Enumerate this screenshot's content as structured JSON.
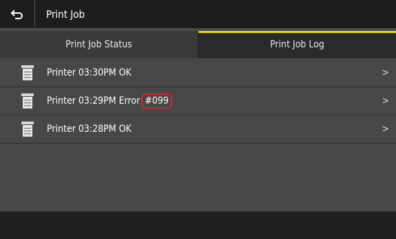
{
  "header": {
    "back_icon": "back-arrow-icon",
    "title": "Print Job"
  },
  "tabs": [
    {
      "label": "Print Job Status",
      "active": false
    },
    {
      "label": "Print Job Log",
      "active": true
    }
  ],
  "log": [
    {
      "icon": "printer-icon",
      "label": "Printer 03:30PM OK"
    },
    {
      "icon": "printer-icon",
      "label_prefix": "Printer 03:29PM Error",
      "error_code": "#099"
    },
    {
      "icon": "printer-icon",
      "label": "Printer 03:28PM OK"
    }
  ],
  "chevron": ">",
  "colors": {
    "accent": "#f5d800",
    "highlight": "#e0232a",
    "background": "#474747",
    "titlebar": "#1d1d1d"
  }
}
